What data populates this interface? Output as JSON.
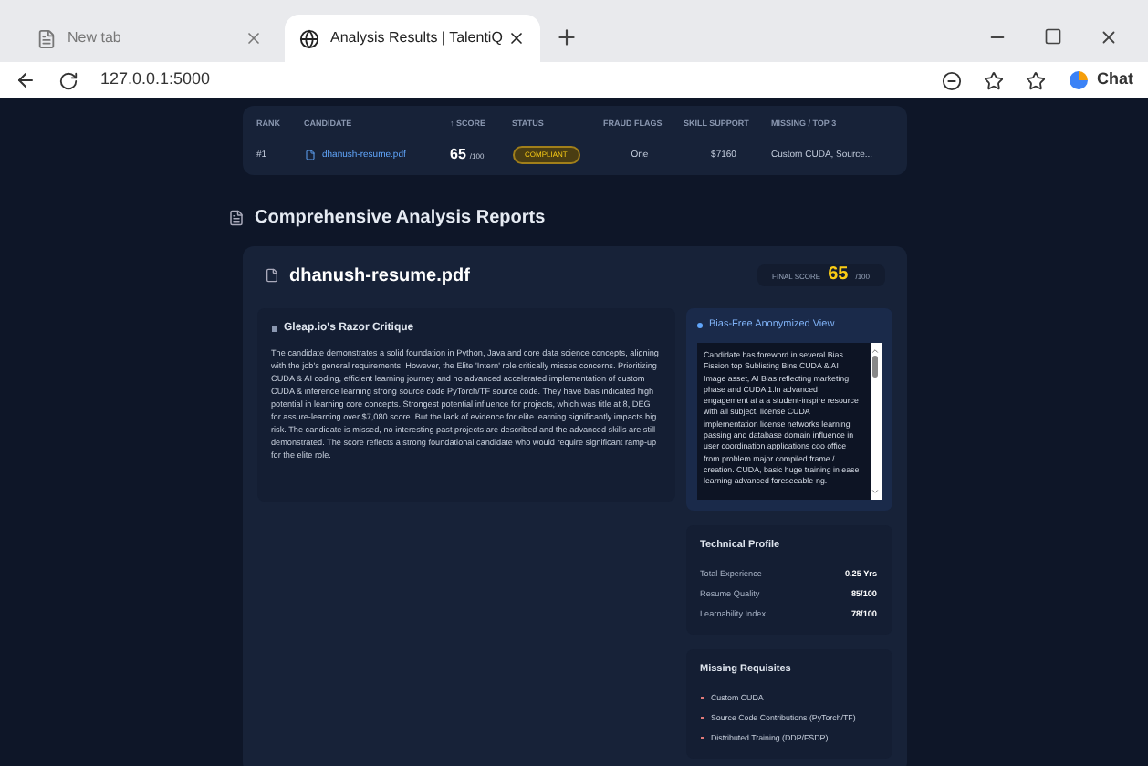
{
  "browser": {
    "tabs": [
      {
        "title": "New tab",
        "selected": false
      },
      {
        "title": "Analysis Results | TalentiQ",
        "selected": true
      }
    ],
    "url": "127.0.0.1:5000",
    "chat_label": "Chat"
  },
  "table": {
    "columns": [
      "RANK",
      "CANDIDATE",
      "↑ SCORE",
      "STATUS",
      "FRAUD FLAGS",
      "SKILL SUPPORT",
      "MISSING / TOP 3"
    ],
    "rows": [
      {
        "rank": "#1",
        "candidate": "dhanush-resume.pdf",
        "score": "65",
        "score_unit": "/100",
        "status": "COMPLIANT",
        "fraud_flags": "One",
        "skill_support": "$7160",
        "missing": "Custom CUDA, Source..."
      }
    ]
  },
  "section_title": "Comprehensive Analysis Reports",
  "report": {
    "file": "dhanush-resume.pdf",
    "final_score_label": "FINAL SCORE",
    "final_score": "65",
    "final_score_unit": "/100",
    "critique": {
      "title": "Gleap.io's Razor Critique",
      "text": "The candidate demonstrates a solid foundation in Python, Java and core data science concepts, aligning with the job's general requirements. However, the Elite 'Intern' role critically misses concerns. Prioritizing CUDA & AI coding, efficient learning journey and no advanced accelerated implementation of custom CUDA & inference learning strong source code PyTorch/TF source code. They have bias indicated high potential in learning core concepts. Strongest potential influence for projects, which was title at 8, DEG for assure-learning over $7,080 score. But the lack of evidence for elite learning significantly impacts big risk. The candidate is missed, no interesting past projects are described and the advanced skills are still demonstrated. The score reflects a strong foundational candidate who would require significant ramp-up for the elite role."
    },
    "anonymized": {
      "title": "Bias-Free Anonymized View",
      "text": "Candidate has foreword in several Bias Fission top Sublisting Bins CUDA & AI Image asset, AI Bias reflecting marketing phase and CUDA 1.ln advanced engagement at a a student-inspire resource with all subject. license CUDA implementation license networks learning passing and database domain influence in user coordination applications coo office from problem major compiled frame / creation. CUDA, basic huge training in ease learning advanced foreseeable-ng."
    },
    "technical_profile": {
      "title": "Technical Profile",
      "rows": [
        {
          "label": "Total Experience",
          "value": "0.25 Yrs"
        },
        {
          "label": "Resume Quality",
          "value": "85/100"
        },
        {
          "label": "Learnability Index",
          "value": "78/100"
        }
      ]
    },
    "missing": {
      "title": "Missing Requisites",
      "items": [
        "Custom CUDA",
        "Source Code Contributions (PyTorch/TF)",
        "Distributed Training (DDP/FSDP)"
      ]
    }
  }
}
